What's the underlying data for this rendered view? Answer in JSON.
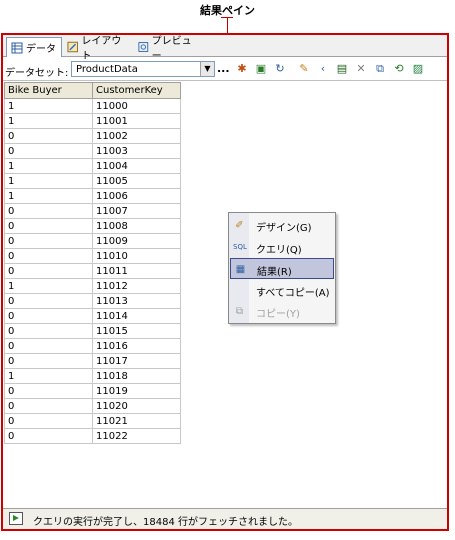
{
  "callout": {
    "label": "結果ペイン"
  },
  "tabs": [
    {
      "label": "データ",
      "icon": "data-icon",
      "active": true
    },
    {
      "label": "レイアウト",
      "icon": "layout-icon",
      "active": false
    },
    {
      "label": "プレビュー",
      "icon": "preview-icon",
      "active": false
    }
  ],
  "toolbar": {
    "dataset_label": "データセット:",
    "dataset_value": "ProductData",
    "ellipsis": "...",
    "icons": [
      "new-dataset-icon",
      "edit-dataset-icon",
      "refresh-fields-icon",
      "command-type-icon",
      "generic-query-icon",
      "delete-icon",
      "run-icon",
      "import-icon",
      "prepare-icon",
      "chart-icon"
    ]
  },
  "grid": {
    "columns": [
      "Bike Buyer",
      "CustomerKey"
    ],
    "rows": [
      [
        "1",
        "11000"
      ],
      [
        "1",
        "11001"
      ],
      [
        "0",
        "11002"
      ],
      [
        "0",
        "11003"
      ],
      [
        "1",
        "11004"
      ],
      [
        "1",
        "11005"
      ],
      [
        "1",
        "11006"
      ],
      [
        "0",
        "11007"
      ],
      [
        "0",
        "11008"
      ],
      [
        "0",
        "11009"
      ],
      [
        "0",
        "11010"
      ],
      [
        "0",
        "11011"
      ],
      [
        "1",
        "11012"
      ],
      [
        "0",
        "11013"
      ],
      [
        "0",
        "11014"
      ],
      [
        "0",
        "11015"
      ],
      [
        "0",
        "11016"
      ],
      [
        "0",
        "11017"
      ],
      [
        "1",
        "11018"
      ],
      [
        "0",
        "11019"
      ],
      [
        "0",
        "11020"
      ],
      [
        "0",
        "11021"
      ],
      [
        "0",
        "11022"
      ]
    ]
  },
  "context_menu": {
    "items": [
      {
        "label": "デザイン(G)",
        "icon": "design-icon",
        "selected": false,
        "disabled": false
      },
      {
        "label": "クエリ(Q)",
        "icon": "query-icon",
        "selected": false,
        "disabled": false
      },
      {
        "label": "結果(R)",
        "icon": "results-icon",
        "selected": true,
        "disabled": false
      },
      {
        "label": "すべてコピー(A)",
        "icon": "",
        "selected": false,
        "disabled": false
      },
      {
        "label": "コピー(Y)",
        "icon": "copy-icon",
        "selected": false,
        "disabled": true
      }
    ]
  },
  "status": {
    "text": "クエリの実行が完了し、18484 行がフェッチされました。"
  }
}
